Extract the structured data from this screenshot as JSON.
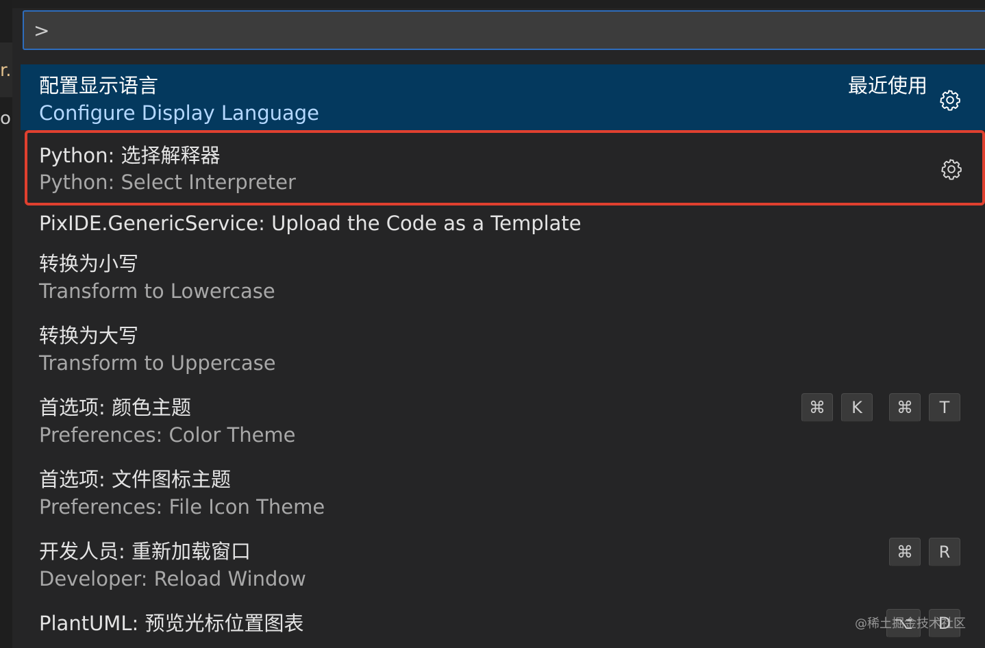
{
  "editor": {
    "fragment_top": "r.",
    "fragment_bottom": "o"
  },
  "quick_input": {
    "value": ">"
  },
  "commands": [
    {
      "label": "配置显示语言",
      "description": "Configure Display Language",
      "recent_label": "最近使用",
      "gear": "gear-icon"
    },
    {
      "label": "Python: 选择解释器",
      "description": "Python: Select Interpreter",
      "gear": "gear-icon"
    },
    {
      "label": "PixIDE.GenericService: Upload the Code as a Template"
    },
    {
      "label": "转换为小写",
      "description": "Transform to Lowercase"
    },
    {
      "label": "转换为大写",
      "description": "Transform to Uppercase"
    },
    {
      "label": "首选项: 颜色主题",
      "description": "Preferences: Color Theme",
      "keybinding": [
        "⌘",
        "K",
        "⌘",
        "T"
      ]
    },
    {
      "label": "首选项: 文件图标主题",
      "description": "Preferences: File Icon Theme"
    },
    {
      "label": "开发人员: 重新加载窗口",
      "description": "Developer: Reload Window",
      "keybinding": [
        "⌘",
        "R"
      ]
    },
    {
      "label": "PlantUML: 预览光标位置图表",
      "keybinding": [
        "⌥",
        "D"
      ]
    }
  ],
  "watermark": "@稀土掘金技术社区",
  "colors": {
    "focus_bg": "#04395e",
    "highlight_border": "#e0402f",
    "input_border": "#2e6dbd"
  }
}
